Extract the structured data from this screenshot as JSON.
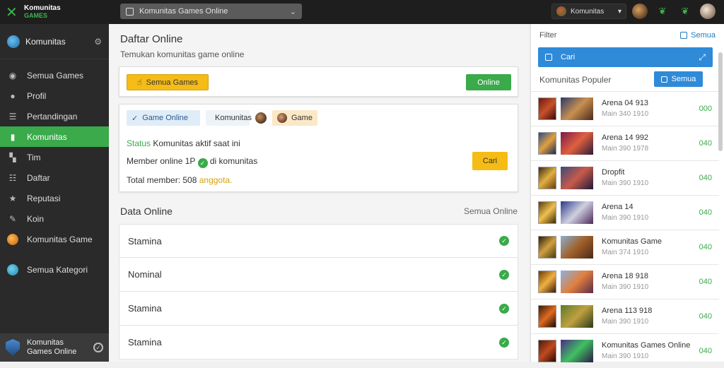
{
  "topbar": {
    "logo_line1": "Komunitas",
    "logo_line2": "GAMES",
    "search_text": "Komunitas Games Online",
    "user_name": "Komunitas"
  },
  "sidebar": {
    "header": "Komunitas",
    "items": [
      {
        "label": "Semua Games",
        "icon": "gamepad-icon"
      },
      {
        "label": "Profil",
        "icon": "user-icon"
      },
      {
        "label": "Pertandingan",
        "icon": "list-icon"
      },
      {
        "label": "Komunitas",
        "icon": "community-icon"
      },
      {
        "label": "Tim",
        "icon": "shield-icon"
      },
      {
        "label": "Daftar",
        "icon": "list-icon"
      },
      {
        "label": "Reputasi",
        "icon": "star-icon"
      },
      {
        "label": "Koin",
        "icon": "coin-icon"
      },
      {
        "label": "Komunitas Game",
        "icon": "orb-icon"
      },
      {
        "label": "Semua Kategori",
        "icon": "globe-icon"
      }
    ],
    "footer_line1": "Komunitas",
    "footer_line2": "Games Online"
  },
  "main": {
    "title": "Daftar Online",
    "subtitle": "Temukan komunitas game online",
    "yellow_button": "Semua Games",
    "green_button": "Online",
    "chips": [
      "Game Online",
      "Komunitas",
      "Game"
    ],
    "line1_prefix": "Status",
    "line1_text": "Komunitas aktif saat ini",
    "line2_text": "Member online 1P",
    "line2_suffix": "di komunitas",
    "line3_text": "Total member: 508",
    "line3_suffix": "anggota.",
    "find_button": "Cari",
    "section_title": "Data Online",
    "section_right": "Semua Online",
    "rows": [
      "Stamina",
      "Nominal",
      "Stamina",
      "Stamina"
    ]
  },
  "right": {
    "head_left": "Filter",
    "head_link": "Semua",
    "blue_bar": "Cari",
    "sub": "Komunitas Populer",
    "button": "Semua",
    "items": [
      {
        "t1": "Arena 04 913",
        "t2": "Main 340 1910",
        "val": "000"
      },
      {
        "t1": "Arena 14 992",
        "t2": "Main 390 1978",
        "val": "040"
      },
      {
        "t1": "Dropfit",
        "t2": "Main 390 1910",
        "val": "040"
      },
      {
        "t1": "Arena 14",
        "t2": "Main 390 1910",
        "val": "040"
      },
      {
        "t1": "Komunitas Game",
        "t2": "Main 374 1910",
        "val": "040"
      },
      {
        "t1": "Arena 18 918",
        "t2": "Main 390 1910",
        "val": "040"
      },
      {
        "t1": "Arena 113 918",
        "t2": "Main 390 1910",
        "val": "040"
      },
      {
        "t1": "Komunitas Games Online",
        "t2": "Main 390 1910",
        "val": "040"
      }
    ]
  }
}
